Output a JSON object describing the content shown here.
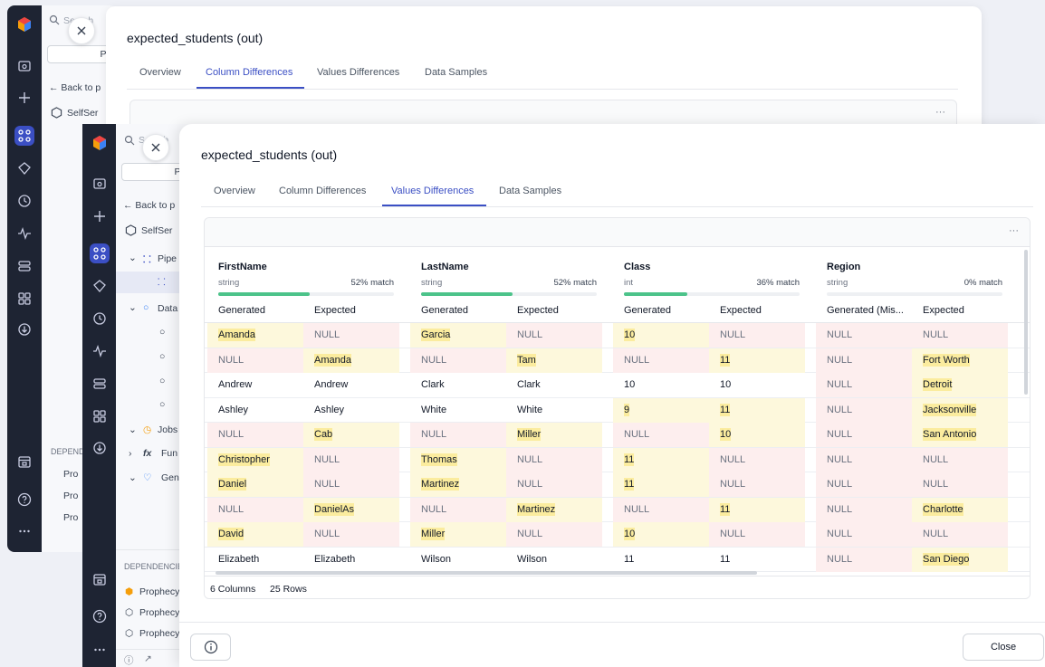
{
  "colors": {
    "accent": "#3b4fc4",
    "rail": "#1e2433",
    "match_bar": "#4cc38a",
    "mismatch_row": "#fdeeee",
    "highlight_cell": "#fdf8dc",
    "highlight_text": "#fbec9e"
  },
  "back_sidebar": {
    "search_placeholder": "Search",
    "project_button": "Proje",
    "back_link": "← Back to p",
    "project_name": "SelfSer",
    "dependencies_label": "DEPEND",
    "dep_items": [
      "Pro",
      "Pro",
      "Pro"
    ]
  },
  "mid_sidebar": {
    "search_placeholder": "Search",
    "project_button": "Proje",
    "back_link": "← Back to p",
    "project_name": "SelfSer",
    "tree": [
      "Pipe",
      "Data",
      "Jobs",
      "Fun",
      "Gen"
    ],
    "dependencies_label": "DEPENDENCIE",
    "dep_items": [
      "Prophecy",
      "Prophecy",
      "Prophecy"
    ]
  },
  "modal_back": {
    "title": "expected_students (out)",
    "tabs": [
      "Overview",
      "Column Differences",
      "Values Differences",
      "Data Samples"
    ],
    "active_tab": "Column Differences",
    "more_label": "···"
  },
  "modal": {
    "title": "expected_students (out)",
    "tabs": [
      "Overview",
      "Column Differences",
      "Values Differences",
      "Data Samples"
    ],
    "active_tab": "Values Differences",
    "more_label": "···",
    "columns": [
      {
        "name": "FirstName",
        "type": "string",
        "match_pct": 52,
        "match_label": "52% match",
        "sub": [
          "Generated",
          "Expected"
        ]
      },
      {
        "name": "LastName",
        "type": "string",
        "match_pct": 52,
        "match_label": "52% match",
        "sub": [
          "Generated",
          "Expected"
        ]
      },
      {
        "name": "Class",
        "type": "int",
        "match_pct": 36,
        "match_label": "36% match",
        "sub": [
          "Generated",
          "Expected"
        ]
      },
      {
        "name": "Region",
        "type": "string",
        "match_pct": 0,
        "match_label": "0% match",
        "sub": [
          "Generated (Mis...",
          "Expected"
        ]
      }
    ],
    "rows": [
      [
        "Amanda",
        "NULL",
        "Garcia",
        "NULL",
        "10",
        "NULL",
        "NULL",
        "NULL"
      ],
      [
        "NULL",
        "Amanda",
        "NULL",
        "Tam",
        "NULL",
        "11",
        "NULL",
        "Fort Worth"
      ],
      [
        "Andrew",
        "Andrew",
        "Clark",
        "Clark",
        "10",
        "10",
        "NULL",
        "Detroit"
      ],
      [
        "Ashley",
        "Ashley",
        "White",
        "White",
        "9",
        "11",
        "NULL",
        "Jacksonville"
      ],
      [
        "NULL",
        "Cab",
        "NULL",
        "Miller",
        "NULL",
        "10",
        "NULL",
        "San Antonio"
      ],
      [
        "Christopher",
        "NULL",
        "Thomas",
        "NULL",
        "11",
        "NULL",
        "NULL",
        "NULL"
      ],
      [
        "Daniel",
        "NULL",
        "Martinez",
        "NULL",
        "11",
        "NULL",
        "NULL",
        "NULL"
      ],
      [
        "NULL",
        "DanielAs",
        "NULL",
        "Martinez",
        "NULL",
        "11",
        "NULL",
        "Charlotte"
      ],
      [
        "David",
        "NULL",
        "Miller",
        "NULL",
        "10",
        "NULL",
        "NULL",
        "NULL"
      ],
      [
        "Elizabeth",
        "Elizabeth",
        "Wilson",
        "Wilson",
        "11",
        "11",
        "NULL",
        "San Diego"
      ]
    ],
    "footer": {
      "columns": "6 Columns",
      "rows": "25 Rows"
    },
    "close_button": "Close"
  }
}
